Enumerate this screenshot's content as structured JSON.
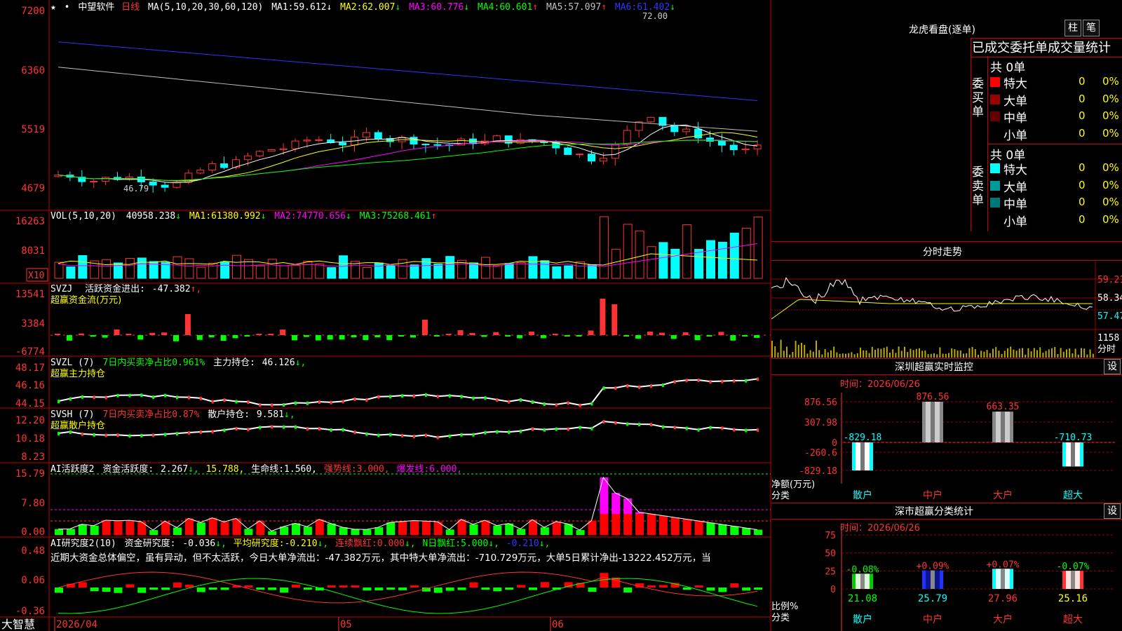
{
  "stock": {
    "name": "中望软件",
    "period": "日线",
    "star": "★",
    "dot": "•"
  },
  "ma_line": {
    "params": "MA(5,10,20,30,60,120)",
    "items": [
      {
        "label": "MA1:",
        "value": "59.612",
        "arrow": "↓",
        "color": "#ffffff"
      },
      {
        "label": "MA2:",
        "value": "62.007",
        "arrow": "↓",
        "color": "#ffff00"
      },
      {
        "label": "MA3:",
        "value": "60.776",
        "arrow": "↓",
        "color": "#ff00ff"
      },
      {
        "label": "MA4:",
        "value": "60.601",
        "arrow": "↑",
        "color": "#00ff00"
      },
      {
        "label": "MA5:",
        "value": "57.097",
        "arrow": "↑",
        "color": "#c0c0c0"
      },
      {
        "label": "MA6:",
        "value": "61.402",
        "arrow": "↓",
        "color": "#3333ff"
      }
    ]
  },
  "price_axis": [
    "7200",
    "6360",
    "5519",
    "4679"
  ],
  "price_marks": {
    "high": "72.00",
    "low": "46.79"
  },
  "vol": {
    "params": "VOL(5,10,20)",
    "value": "40958.238",
    "arrow1": "↓",
    "ma1_label": "MA1:",
    "ma1": "61380.992",
    "ma1_arrow": "↓",
    "ma2_label": "MA2:",
    "ma2": "74770.656",
    "ma2_arrow": "↓",
    "ma3_label": "MA3:",
    "ma3": "75268.461",
    "ma3_arrow": "↑",
    "axis": [
      "16263",
      "8031"
    ],
    "unit": "X10"
  },
  "svzj": {
    "title": "SVZJ",
    "label": "活跃资金进出:",
    "value": "-47.382",
    "arrow": "↑,",
    "sub": "超赢资金流(万元)",
    "axis": [
      "13541",
      "3384",
      "-6774"
    ]
  },
  "svzl": {
    "title": "SVZL (7)",
    "label": "7日内买卖净占比0.961%",
    "label2": "主力持仓:",
    "value": "46.126",
    "arrow": "↓,",
    "sub": "超赢主力持仓",
    "axis": [
      "48.17",
      "46.16",
      "44.15"
    ]
  },
  "svsh": {
    "title": "SVSH (7)",
    "label": "7日内买卖净占比0.87%",
    "label2": "散户持仓:",
    "value": "9.581",
    "arrow": "↓,",
    "sub": "超赢散户持仓",
    "axis": [
      "12.20",
      "10.18",
      "8.23"
    ]
  },
  "ai1": {
    "title": "AI活跃度2",
    "label": "资金活跃度:",
    "value": "2.267",
    "arrow": "↓,",
    "v2": "15.788,",
    "l3": "生命线:",
    "v3": "1.560,",
    "l4": "强势线:",
    "v4": "3.000,",
    "l5": "爆发线:",
    "v5": "6.000,",
    "axis": [
      "15.79",
      "7.80",
      "0.00"
    ]
  },
  "ai2": {
    "title": "AI研究度2(10)",
    "label": "资金研究度:",
    "value": "-0.036",
    "arrow": "↓,",
    "l2": "平均研究度:",
    "v2": "-0.210",
    "a2": "↓,",
    "l3": "连续飘红:",
    "v3": "0.000",
    "a3": "↓,",
    "l4": "N日飘红:",
    "v4": "5.000",
    "a4": "↓,",
    "v5": "-0.210",
    "a5": "↓,",
    "axis": [
      "0.48",
      "0.06",
      "-0.36"
    ],
    "note": "近期大资金总体偏空，虽有异动，但不太活跃，今日大单净流出：-47.382万元，其中特大单净流出：-710.729万元，大单5日累计净出-13222.452万元，当"
  },
  "date_axis": [
    "2026/04",
    "05",
    "06"
  ],
  "brand": "大智慧",
  "longhu": {
    "title": "龙虎看盘(逐单)",
    "btn1": "柱",
    "btn2": "笔",
    "header": "已成交委托单成交量统计",
    "buy": {
      "side": "委买单",
      "total": "共 0单",
      "rows": [
        {
          "name": "特大",
          "val": "0",
          "pct": "0%",
          "color": "#ff0000"
        },
        {
          "name": "大单",
          "val": "0",
          "pct": "0%",
          "color": "#990000"
        },
        {
          "name": "中单",
          "val": "0",
          "pct": "0%",
          "color": "#660000"
        },
        {
          "name": "小单",
          "val": "0",
          "pct": "0%",
          "color": "#000000"
        }
      ]
    },
    "sell": {
      "side": "委卖单",
      "total": "共 0单",
      "rows": [
        {
          "name": "特大",
          "val": "0",
          "pct": "0%",
          "color": "#00ffff"
        },
        {
          "name": "大单",
          "val": "0",
          "pct": "0%",
          "color": "#009999"
        },
        {
          "name": "中单",
          "val": "0",
          "pct": "0%",
          "color": "#007777"
        },
        {
          "name": "小单",
          "val": "0",
          "pct": "0%",
          "color": "#000000"
        }
      ]
    }
  },
  "fenshi": {
    "title": "分时走势",
    "axis": [
      "59.21",
      "58.34",
      "57.47"
    ],
    "vol_label": "1158",
    "unit": "分时"
  },
  "monitor": {
    "title": "深圳超赢实时监控",
    "btn": "设",
    "time_label": "时间：2026/06/26",
    "axis": [
      "876.56",
      "307.98",
      "0",
      "-260.6",
      "-829.18"
    ],
    "ylabel1": "净额(万元)",
    "ylabel2": "分类",
    "categories": [
      "散户",
      "中户",
      "大户",
      "超大"
    ],
    "values": [
      -829.18,
      876.56,
      663.35,
      -710.73
    ],
    "labels": [
      "-829.18",
      "876.56",
      "663.35",
      "-710.73"
    ]
  },
  "classify": {
    "title": "深市超赢分类统计",
    "btn": "设",
    "time_label": "时间：2026/06/26",
    "axis": [
      "75",
      "50",
      "25",
      "0"
    ],
    "ylabel1": "比例%",
    "ylabel2": "分类",
    "categories": [
      "散户",
      "中户",
      "大户",
      "超大"
    ],
    "values": [
      21.08,
      25.79,
      27.96,
      25.16
    ],
    "value_labels": [
      "21.08",
      "25.79",
      "27.96",
      "25.16"
    ],
    "changes": [
      "-0.08%",
      "+0.09%",
      "+0.07%",
      "-0.07%"
    ],
    "colors": [
      "#00cc00",
      "#2233ff",
      "#00ffff",
      "#ff3333"
    ]
  },
  "colors": {
    "up": "#ff3333",
    "down": "#00ffff",
    "grid": "#b00000",
    "axis_text": "#ff3333"
  }
}
